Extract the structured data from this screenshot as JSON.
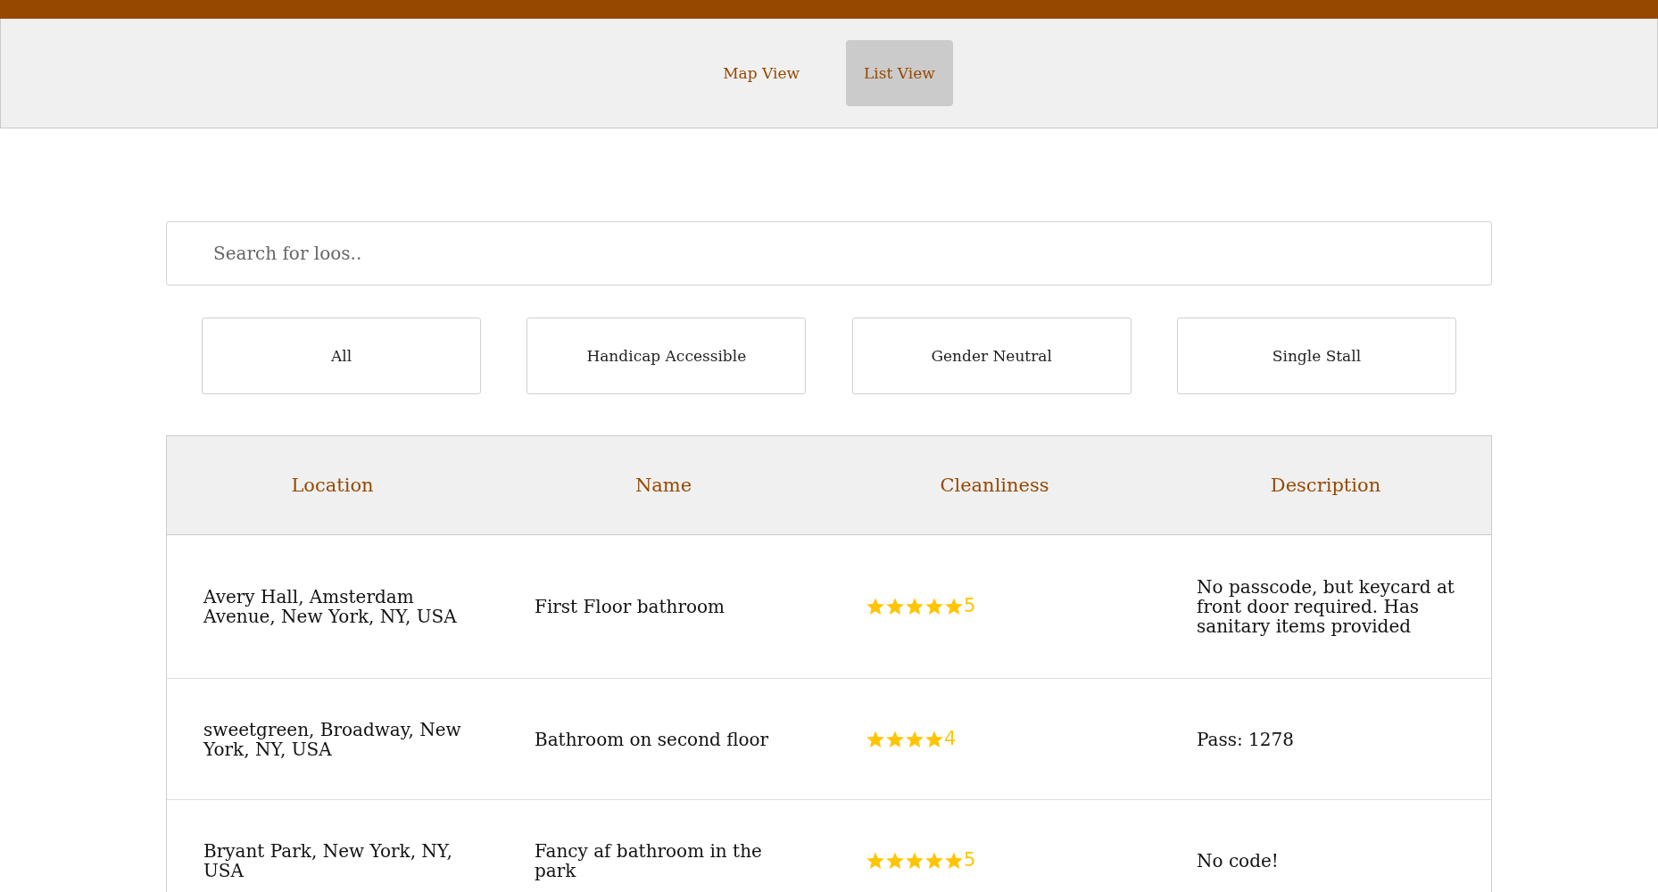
{
  "nav": {
    "tabs": [
      {
        "label": "Map View",
        "selected": false
      },
      {
        "label": "List View",
        "selected": true
      }
    ]
  },
  "search": {
    "placeholder": "Search for loos.."
  },
  "filters": [
    "All",
    "Handicap Accessible",
    "Gender Neutral",
    "Single Stall"
  ],
  "table": {
    "columns": [
      "Location",
      "Name",
      "Cleanliness",
      "Description"
    ],
    "rows": [
      {
        "location": "Avery Hall, Amsterdam Avenue, New York, NY, USA",
        "name": "First Floor bathroom",
        "stars": 5,
        "rating": "5",
        "description": "No passcode, but keycard at front door required. Has sanitary items provided"
      },
      {
        "location": "sweetgreen, Broadway, New York, NY, USA",
        "name": "Bathroom on second floor",
        "stars": 4,
        "rating": "4",
        "description": "Pass: 1278"
      },
      {
        "location": "Bryant Park, New York, NY, USA",
        "name": "Fancy af bathroom in the park",
        "stars": 5,
        "rating": "5",
        "description": "No code!"
      }
    ]
  }
}
